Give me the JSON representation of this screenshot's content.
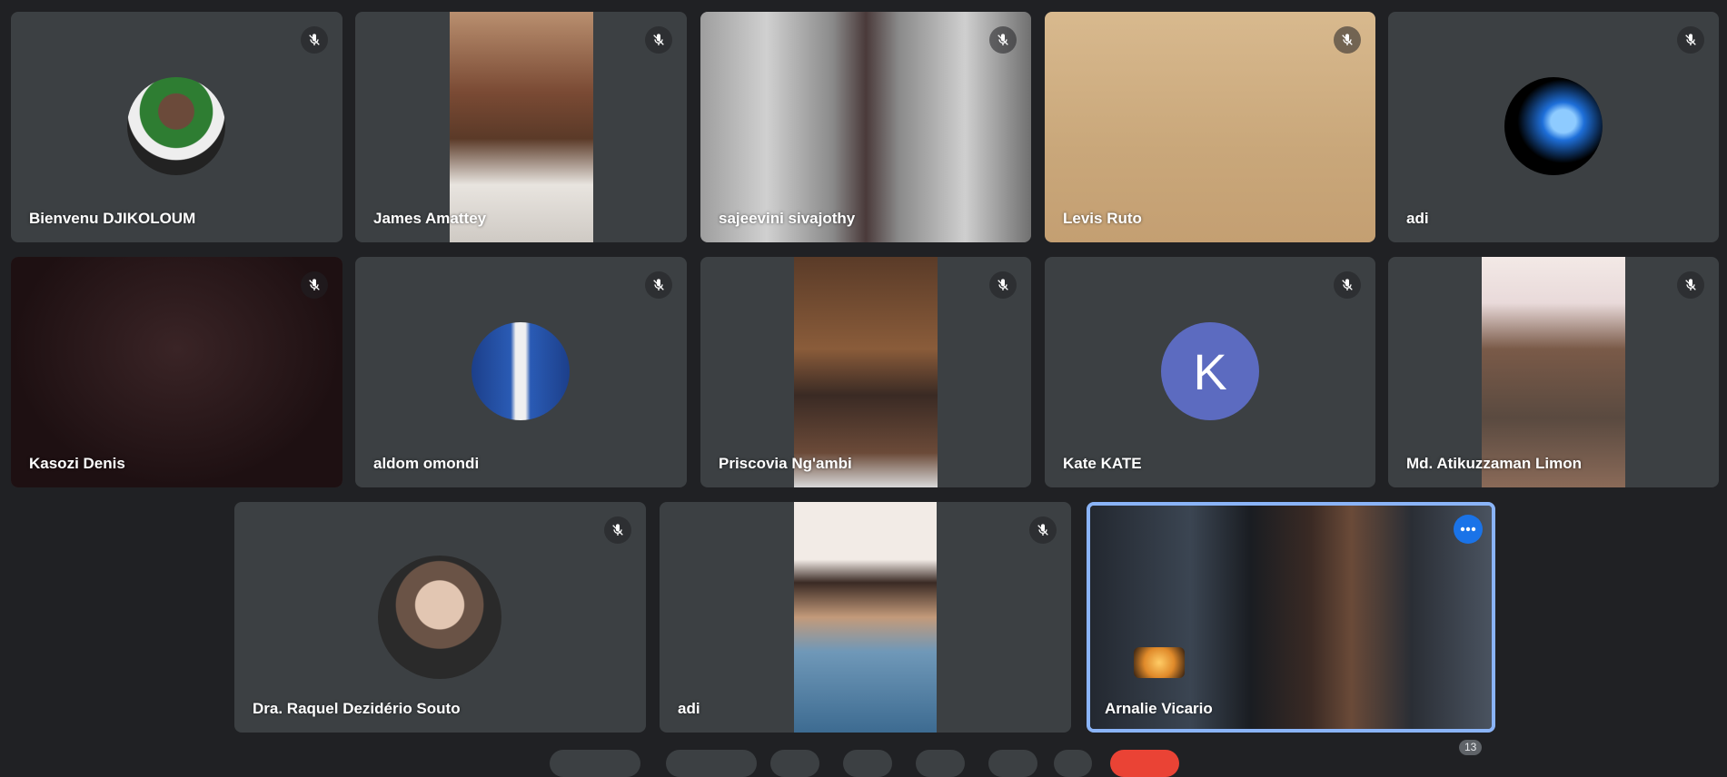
{
  "participants": [
    {
      "name": "Bienvenu DJIKOLOUM",
      "muted": true,
      "view": "avatar"
    },
    {
      "name": "James Amattey",
      "muted": true,
      "view": "video"
    },
    {
      "name": "sajeevini sivajothy",
      "muted": true,
      "view": "video"
    },
    {
      "name": "Levis Ruto",
      "muted": true,
      "view": "video"
    },
    {
      "name": "adi",
      "muted": true,
      "view": "avatar"
    },
    {
      "name": "Kasozi Denis",
      "muted": true,
      "view": "video"
    },
    {
      "name": "aldom omondi",
      "muted": true,
      "view": "avatar"
    },
    {
      "name": "Priscovia Ng'ambi",
      "muted": true,
      "view": "video"
    },
    {
      "name": "Kate KATE",
      "muted": true,
      "view": "initial",
      "initial": "K"
    },
    {
      "name": "Md. Atikuzzaman Limon",
      "muted": true,
      "view": "video"
    },
    {
      "name": "Dra. Raquel Dezidério Souto",
      "muted": true,
      "view": "avatar"
    },
    {
      "name": "adi",
      "muted": true,
      "view": "video"
    },
    {
      "name": "Arnalie Vicario",
      "muted": false,
      "view": "video",
      "speaking": true
    }
  ],
  "people_count": "13",
  "colors": {
    "background": "#202124",
    "tile": "#3c4043",
    "accent": "#8ab4f8",
    "menu_button": "#1a73e8",
    "initial_avatar": "#5c6bc0"
  },
  "icons": {
    "mute": "mic-off-icon",
    "more": "more-options-icon"
  }
}
